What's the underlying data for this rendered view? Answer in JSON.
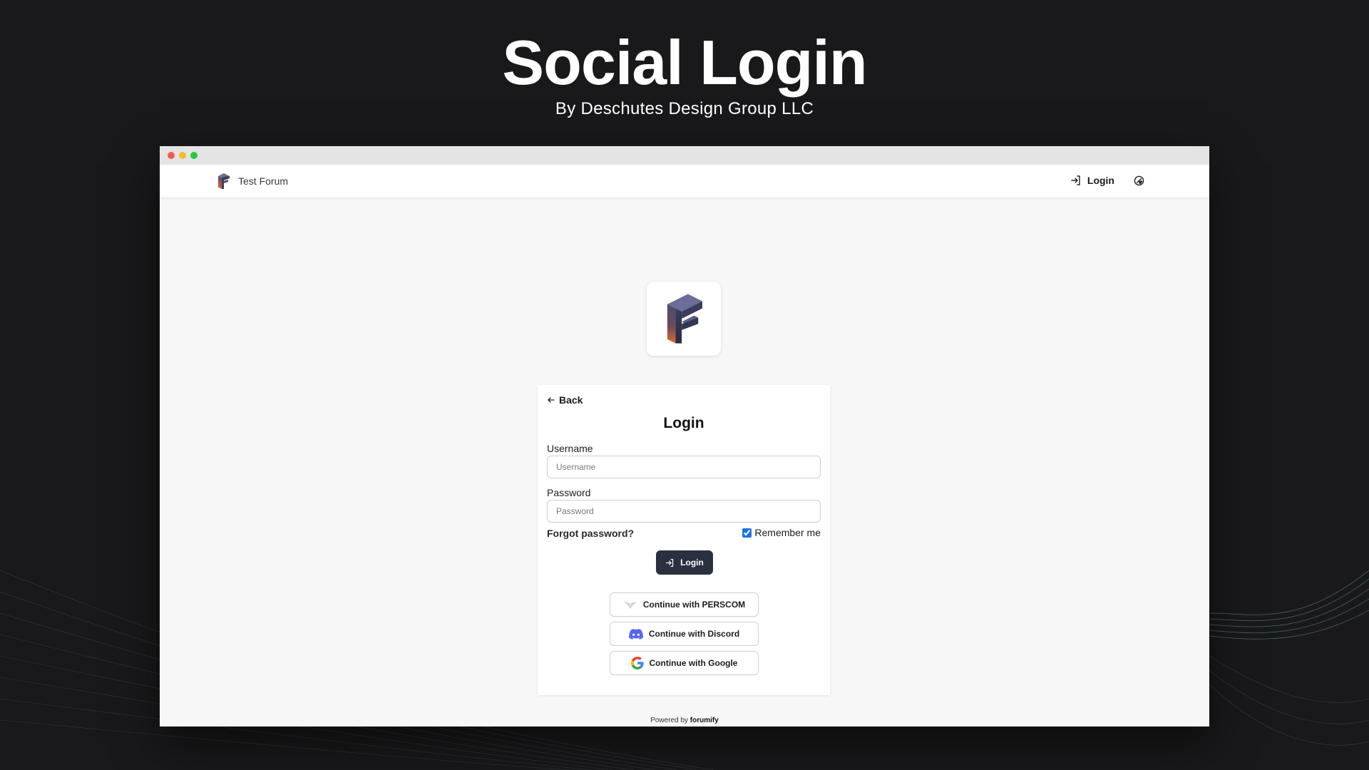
{
  "hero": {
    "title": "Social Login",
    "subtitle": "By Deschutes Design Group LLC"
  },
  "navbar": {
    "brand_name": "Test Forum",
    "login_label": "Login",
    "login_icon": "login-arrow-icon",
    "theme_icon": "theme-toggle-icon"
  },
  "login_card": {
    "back_label": "Back",
    "title": "Login",
    "username": {
      "label": "Username",
      "placeholder": "Username",
      "value": ""
    },
    "password": {
      "label": "Password",
      "placeholder": "Password",
      "value": ""
    },
    "forgot_label": "Forgot password?",
    "remember_label": "Remember me",
    "remember_checked": true,
    "submit_label": "Login",
    "social_buttons": [
      {
        "label": "Continue with PERSCOM",
        "icon": "perscom-icon"
      },
      {
        "label": "Continue with Discord",
        "icon": "discord-icon"
      },
      {
        "label": "Continue with Google",
        "icon": "google-icon"
      }
    ]
  },
  "footer": {
    "powered_prefix": "Powered by",
    "powered_brand": "forumify"
  },
  "colors": {
    "background": "#19191b",
    "primary_button": "#2b3040",
    "logo_top": "#4a4d72",
    "logo_bottom": "#e06a2a",
    "checkbox": "#1a73e8",
    "discord": "#5865f2"
  }
}
